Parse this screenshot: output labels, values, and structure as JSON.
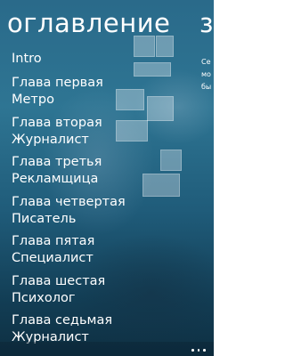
{
  "panorama": {
    "title": "оглавление",
    "next_section_title": "з",
    "next_section_peek": [
      "Се",
      "мо",
      "бы"
    ]
  },
  "toc": {
    "items": [
      {
        "lines": [
          "Intro"
        ]
      },
      {
        "lines": [
          "Глава первая",
          "Метро"
        ]
      },
      {
        "lines": [
          "Глава вторая",
          "Журналист"
        ]
      },
      {
        "lines": [
          "Глава третья",
          "Рекламщица"
        ]
      },
      {
        "lines": [
          "Глава четвертая",
          "Писатель"
        ]
      },
      {
        "lines": [
          "Глава пятая",
          "Специалист"
        ]
      },
      {
        "lines": [
          "Глава шестая",
          "Психолог"
        ]
      },
      {
        "lines": [
          "Глава седьмая",
          "Журналист"
        ]
      }
    ]
  },
  "appbar": {
    "more_icon": "ellipsis-icon"
  }
}
